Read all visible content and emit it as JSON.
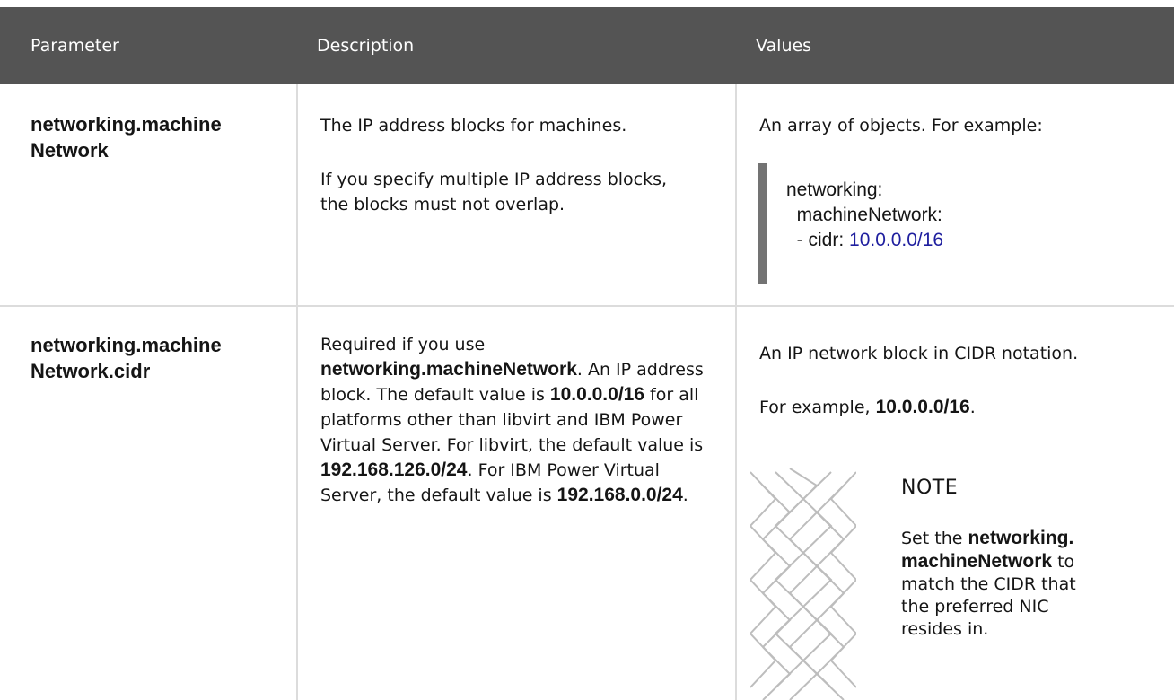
{
  "table": {
    "headers": [
      "Parameter",
      "Description",
      "Values"
    ],
    "rows": [
      {
        "parameter_line1": "networking.machine",
        "parameter_line2": "Network",
        "description_p1": "The IP address blocks for machines.",
        "description_p2": "If you specify multiple IP address blocks, the blocks must not overlap.",
        "values_intro": "An array of objects. For example:",
        "code_line1": "networking:",
        "code_line2": "  machineNetwork:",
        "code_line3_key": "  - cidr: ",
        "code_line3_value": "10.0.0.0/16"
      },
      {
        "parameter_line1": "networking.machine",
        "parameter_line2": "Network.cidr",
        "description_parts": [
          "Required if you use ",
          "networking.machineNetwork",
          ". An IP address block. The default value is ",
          "10.0.0.0/16",
          " for all platforms other than libvirt and IBM Power Virtual Server. For libvirt, the default value is ",
          "192.168.126.0/24",
          ". For IBM Power Virtual Server, the default value is ",
          "192.168.0.0/24",
          "."
        ],
        "values_intro": "An IP network block in CIDR notation.",
        "values_example_prefix": "For example, ",
        "values_example_value": "10.0.0.0/16",
        "values_example_suffix": ".",
        "note": {
          "icon": "note-pattern-icon",
          "title": "NOTE",
          "text_before": "Set the ",
          "text_bold": "networking.machineNetwork",
          "text_after": " to match the CIDR that the preferred NIC resides in."
        }
      }
    ]
  },
  "colors": {
    "header_bg": "#545454",
    "header_text": "#ffffff",
    "border": "#dcdcdc",
    "code_bar": "#737373",
    "code_value": "#1f1f9f"
  }
}
